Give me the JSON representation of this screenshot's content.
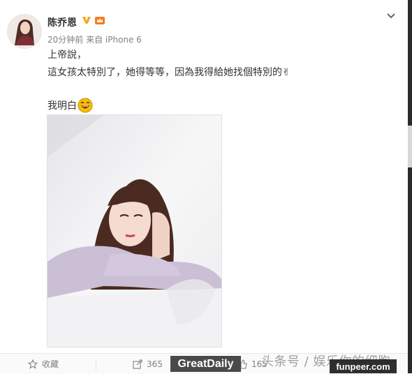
{
  "post": {
    "username": "陈乔恩",
    "meta": "20分钟前 来自 iPhone 6",
    "lines": [
      "上帝說，",
      "這女孩太特別了，她得等等，因為我得給她找個特別的✌",
      "我明白"
    ]
  },
  "actions": {
    "favorite_label": "收藏",
    "forward_count": "365",
    "like_count": "165"
  },
  "watermarks": {
    "greatdaily": "GreatDaily",
    "toutiao": "头条号 / 娱乐你的细胞",
    "funpeer": "funpeer.com"
  },
  "colors": {
    "username": "#333333",
    "meta": "#808080",
    "verified_badge": "#f5a623",
    "emoji": "#f6c000"
  },
  "icons": [
    "verified-icon",
    "member-icon",
    "chevron-down-icon",
    "star-icon",
    "forward-icon",
    "like-icon",
    "laughing-emoji-icon",
    "peace-hand-icon"
  ]
}
